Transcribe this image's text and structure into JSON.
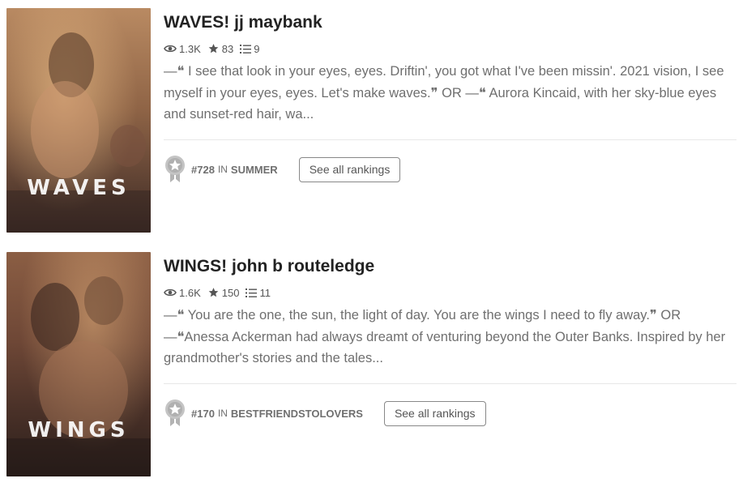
{
  "stories": [
    {
      "cover_text": "WAVES",
      "title": "WAVES! jj maybank",
      "reads": "1.3K",
      "votes": "83",
      "parts": "9",
      "description": "—❝ I see that look in your eyes, eyes. Driftin', you got what I've been missin'. 2021 vision, I see myself in your eyes, eyes. Let's make waves.❞ OR —❝ Aurora Kincaid, with her sky-blue eyes and sunset-red hair, wa...",
      "rank_number": "#728",
      "rank_in": "IN",
      "rank_category": "SUMMER",
      "see_all_label": "See all rankings"
    },
    {
      "cover_text": "WINGS",
      "title": "WINGS! john b routeledge",
      "reads": "1.6K",
      "votes": "150",
      "parts": "11",
      "description": "—❝ You are the one, the sun, the light of day. You are the wings I need to fly away.❞ OR —❝Anessa Ackerman had always dreamt of venturing beyond the Outer Banks. Inspired by her grandmother's stories and the tales...",
      "rank_number": "#170",
      "rank_in": "IN",
      "rank_category": "BESTFRIENDSTOLOVERS",
      "see_all_label": "See all rankings"
    }
  ],
  "icons": {
    "reads": "eye-icon",
    "votes": "star-icon",
    "parts": "list-icon",
    "rank": "medal-icon"
  },
  "colors": {
    "title": "#222222",
    "meta": "#555555",
    "description": "#6f6f6f",
    "medal": "#b3b3b3"
  }
}
